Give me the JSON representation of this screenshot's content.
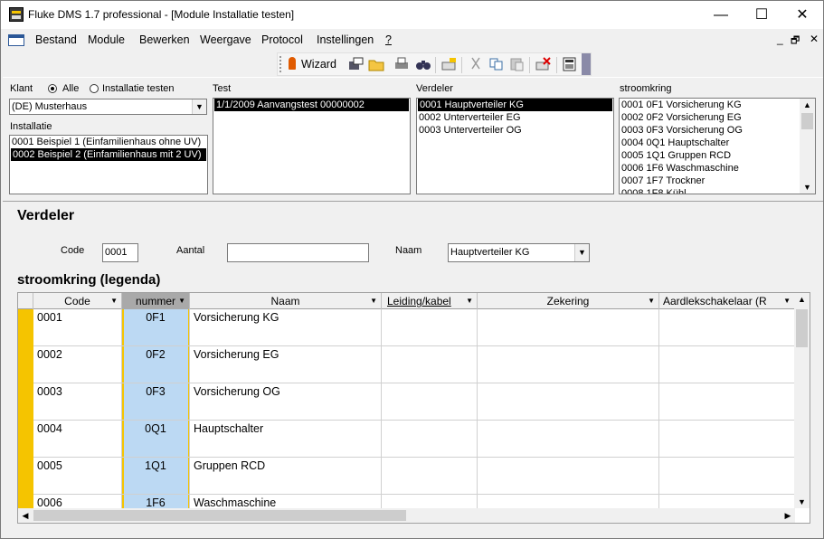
{
  "window": {
    "title": "Fluke DMS 1.7 professional - [Module Installatie testen]",
    "minimize": "—",
    "maximize": "☐",
    "close": "✕"
  },
  "menu": {
    "items": [
      "Bestand",
      "Module",
      "Bewerken",
      "Weergave",
      "Protocol",
      "Instellingen",
      "?"
    ],
    "mdi_minimize": "_",
    "mdi_restore": "🗗",
    "mdi_close": "✕"
  },
  "toolbar": {
    "wizard_label": "Wizard"
  },
  "klant": {
    "label": "Klant",
    "radio_all": "Alle",
    "radio_test": "Installatie testen",
    "selected": "(DE) Musterhaus"
  },
  "installatie": {
    "label": "Installatie",
    "items": [
      "0001  Beispiel 1 (Einfamilienhaus ohne UV)",
      "0002  Beispiel 2 (Einfamilienhaus mit 2 UV)"
    ]
  },
  "test": {
    "label": "Test",
    "items": [
      "1/1/2009 Aanvangstest 00000002"
    ]
  },
  "verdeler_list": {
    "label": "Verdeler",
    "items": [
      "0001  Hauptverteiler KG",
      "0002  Unterverteiler EG",
      "0003  Unterverteiler OG"
    ]
  },
  "stroomkring_list": {
    "label": "stroomkring",
    "items": [
      "0001 0F1 Vorsicherung KG",
      "0002 0F2 Vorsicherung EG",
      "0003 0F3 Vorsicherung OG",
      "0004 0Q1 Hauptschalter",
      "0005 1Q1 Gruppen RCD",
      "0006 1F6 Waschmaschine",
      "0007 1F7 Trockner",
      "0008 1F8 Kühl..."
    ]
  },
  "verdeler_section": {
    "heading": "Verdeler",
    "code_label": "Code",
    "code_value": "0001",
    "aantal_label": "Aantal",
    "aantal_value": "",
    "naam_label": "Naam",
    "naam_value": "Hauptverteiler KG"
  },
  "grid": {
    "heading": "stroomkring (legenda)",
    "columns": [
      "Code",
      "nummer",
      "Naam",
      "Leiding/kabel",
      "Zekering",
      "Aardlekschakelaar (R"
    ],
    "rows": [
      [
        "0001",
        "0F1",
        "Vorsicherung KG",
        "",
        "",
        ""
      ],
      [
        "0002",
        "0F2",
        "Vorsicherung EG",
        "",
        "",
        ""
      ],
      [
        "0003",
        "0F3",
        "Vorsicherung OG",
        "",
        "",
        ""
      ],
      [
        "0004",
        "0Q1",
        "Hauptschalter",
        "",
        "",
        ""
      ],
      [
        "0005",
        "1Q1",
        "Gruppen RCD",
        "",
        "",
        ""
      ],
      [
        "0006",
        "1F6",
        "Waschmaschine",
        "",
        "",
        ""
      ]
    ]
  }
}
